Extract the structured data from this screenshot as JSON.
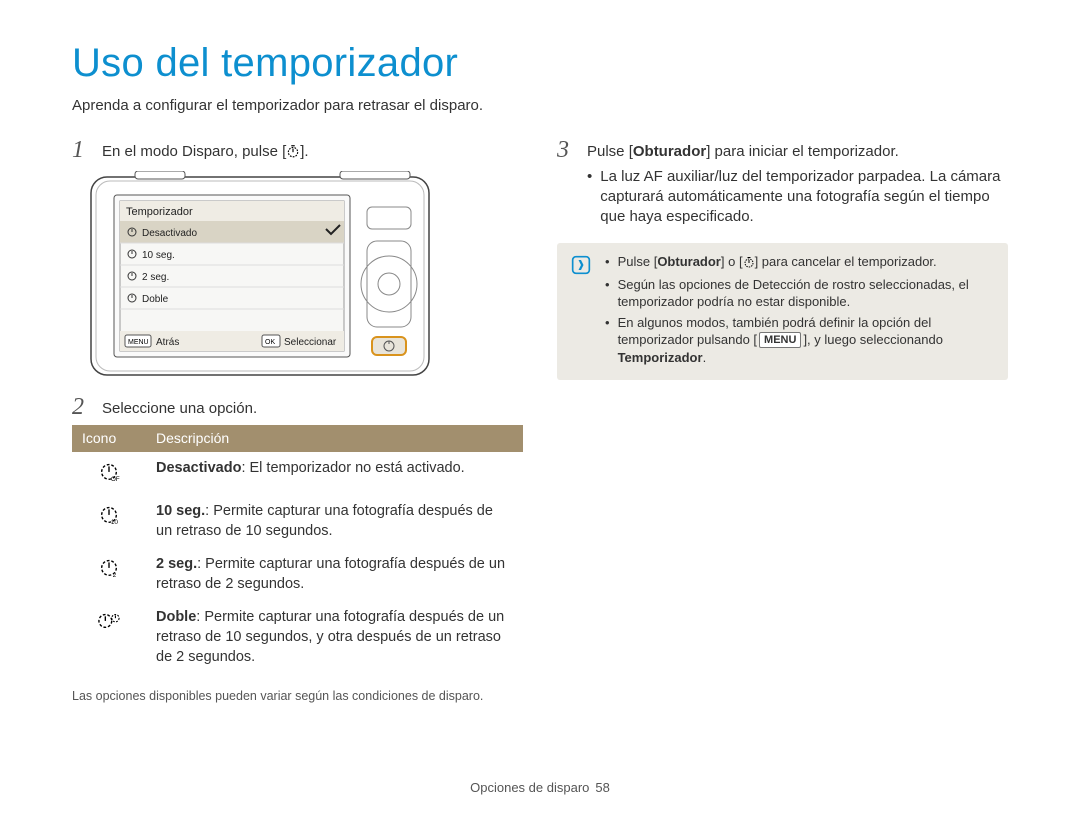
{
  "title": "Uso del temporizador",
  "lead": "Aprenda a configurar el temporizador para retrasar el disparo.",
  "step1": {
    "num": "1",
    "text_prefix": "En el modo Disparo, pulse [",
    "text_suffix": "]."
  },
  "camera_menu": {
    "header": "Temporizador",
    "items": [
      "Desactivado",
      "10 seg.",
      "2 seg.",
      "Doble"
    ],
    "back_kbd": "MENU",
    "back_label": "Atrás",
    "ok_kbd": "OK",
    "ok_label": "Seleccionar"
  },
  "step2": {
    "num": "2",
    "text": "Seleccione una opción."
  },
  "table": {
    "head_icon": "Icono",
    "head_desc": "Descripción",
    "rows": [
      {
        "icon": "timer-off-icon",
        "bold": "Desactivado",
        "rest": ": El temporizador no está activado."
      },
      {
        "icon": "timer-10-icon",
        "bold": "10 seg.",
        "rest": ": Permite capturar una fotografía después de un retraso de 10 segundos."
      },
      {
        "icon": "timer-2-icon",
        "bold": "2 seg.",
        "rest": ": Permite capturar una fotografía después de un retraso de 2 segundos."
      },
      {
        "icon": "timer-double-icon",
        "bold": "Doble",
        "rest": ": Permite capturar una fotografía después de un retraso de 10 segundos, y otra después de un retraso de 2 segundos."
      }
    ]
  },
  "opts_note": "Las opciones disponibles pueden variar según las condiciones de disparo.",
  "step3": {
    "num": "3",
    "text_pre": "Pulse [",
    "shutter": "Obturador",
    "text_post": "] para iniciar el temporizador.",
    "bullet": "La luz AF auxiliar/luz del temporizador parpadea. La cámara capturará automáticamente una fotografía según el tiempo que haya especificado."
  },
  "info": {
    "b1_pre": "Pulse [",
    "b1_shutter": "Obturador",
    "b1_mid": "] o [",
    "b1_post": "] para cancelar el temporizador.",
    "b2": "Según las opciones de Detección de rostro seleccionadas, el temporizador podría no estar disponible.",
    "b3_pre": "En algunos modos, también podrá definir la opción del temporizador pulsando [",
    "b3_menu": "MENU",
    "b3_mid": "], y luego seleccionando ",
    "b3_bold": "Temporizador",
    "b3_post": "."
  },
  "footer": {
    "section": "Opciones de disparo",
    "page": "58"
  }
}
